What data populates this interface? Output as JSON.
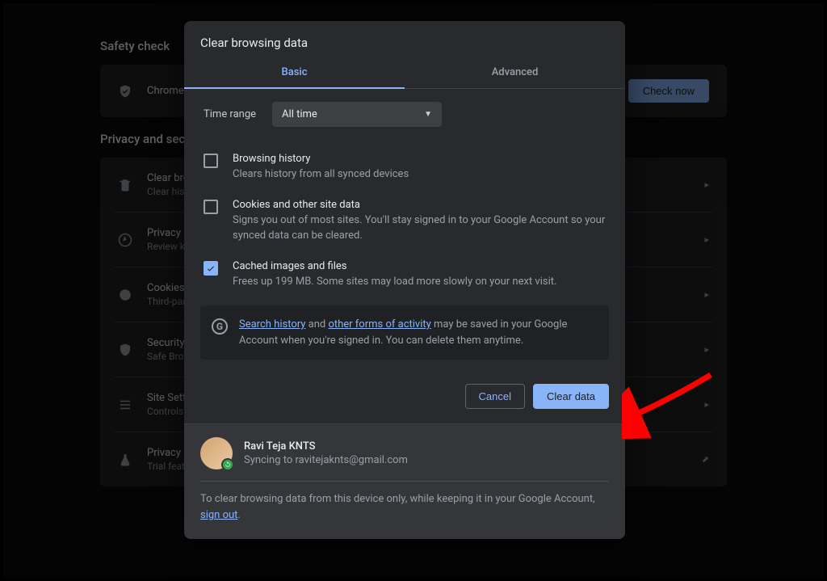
{
  "bg": {
    "safety_heading": "Safety check",
    "privacy_heading": "Privacy and security",
    "check_row": {
      "title": "Chrome can help keep you safe",
      "button": "Check now"
    },
    "rows": [
      {
        "title": "Clear browsing data",
        "sub": "Clear history, cookies, cache, and more"
      },
      {
        "title": "Privacy Guide",
        "sub": "Review key privacy and security controls"
      },
      {
        "title": "Cookies and other site data",
        "sub": "Third-party cookies are blocked in Incognito mode"
      },
      {
        "title": "Security",
        "sub": "Safe Browsing (protection from dangerous sites) and other security settings"
      },
      {
        "title": "Site Settings",
        "sub": "Controls what information sites can use and show"
      },
      {
        "title": "Privacy Sandbox",
        "sub": "Trial features are on"
      }
    ]
  },
  "modal": {
    "title": "Clear browsing data",
    "tabs": {
      "basic": "Basic",
      "advanced": "Advanced"
    },
    "time_label": "Time range",
    "time_value": "All time",
    "options": [
      {
        "title": "Browsing history",
        "desc": "Clears history from all synced devices",
        "checked": false
      },
      {
        "title": "Cookies and other site data",
        "desc": "Signs you out of most sites. You'll stay signed in to your Google Account so your synced data can be cleared.",
        "checked": false
      },
      {
        "title": "Cached images and files",
        "desc": "Frees up 199 MB. Some sites may load more slowly on your next visit.",
        "checked": true
      }
    ],
    "info": {
      "link1": "Search history",
      "mid1": " and ",
      "link2": "other forms of activity",
      "tail": " may be saved in your Google Account when you're signed in. You can delete them anytime."
    },
    "cancel": "Cancel",
    "clear": "Clear data",
    "profile": {
      "name": "Ravi Teja KNTS",
      "sync": "Syncing to ravitejaknts@gmail.com"
    },
    "footer": {
      "pre": "To clear browsing data from this device only, while keeping it in your Google Account, ",
      "link": "sign out",
      "post": "."
    }
  }
}
